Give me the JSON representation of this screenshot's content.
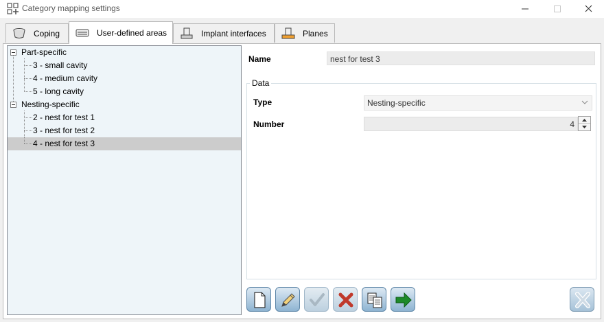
{
  "window": {
    "title": "Category mapping settings",
    "controls": {
      "minimize": "minimize-icon",
      "maximize": "maximize-icon",
      "close": "close-icon"
    }
  },
  "tabs": [
    {
      "label": "Coping",
      "icon": "coping-icon",
      "active": false
    },
    {
      "label": "User-defined areas",
      "icon": "user-defined-areas-icon",
      "active": true
    },
    {
      "label": "Implant interfaces",
      "icon": "implant-interface-icon",
      "active": false
    },
    {
      "label": "Planes",
      "icon": "plane-icon",
      "active": false
    }
  ],
  "tree": {
    "groups": [
      {
        "label": "Part-specific",
        "expanded": true,
        "items": [
          {
            "label": "3 - small cavity"
          },
          {
            "label": "4 - medium cavity"
          },
          {
            "label": "5 - long cavity"
          }
        ]
      },
      {
        "label": "Nesting-specific",
        "expanded": true,
        "items": [
          {
            "label": "2 - nest for test 1"
          },
          {
            "label": "3 - nest for test 2"
          },
          {
            "label": "4 - nest for test 3",
            "selected": true
          }
        ]
      }
    ]
  },
  "details": {
    "name_label": "Name",
    "name_value": "nest for test 3",
    "group_title": "Data",
    "type_label": "Type",
    "type_value": "Nesting-specific",
    "number_label": "Number",
    "number_value": "4"
  },
  "toolbar": {
    "buttons": [
      {
        "name": "new-button",
        "icon": "new-document-icon",
        "enabled": true
      },
      {
        "name": "edit-button",
        "icon": "pencil-icon",
        "enabled": true
      },
      {
        "name": "apply-button",
        "icon": "checkmark-icon",
        "enabled": false
      },
      {
        "name": "delete-button",
        "icon": "delete-x-icon",
        "enabled": false
      },
      {
        "name": "copy-button",
        "icon": "copy-icon",
        "enabled": true
      },
      {
        "name": "export-button",
        "icon": "green-arrow-icon",
        "enabled": true
      }
    ],
    "close_icon": "close-x-icon"
  },
  "colors": {
    "tree_background": "#eef5f9",
    "selection": "#cccccc",
    "button_top": "#dde9f3",
    "button_bottom": "#8eb4d2",
    "delete_red": "#c0392b",
    "arrow_green": "#1e8a2a"
  }
}
